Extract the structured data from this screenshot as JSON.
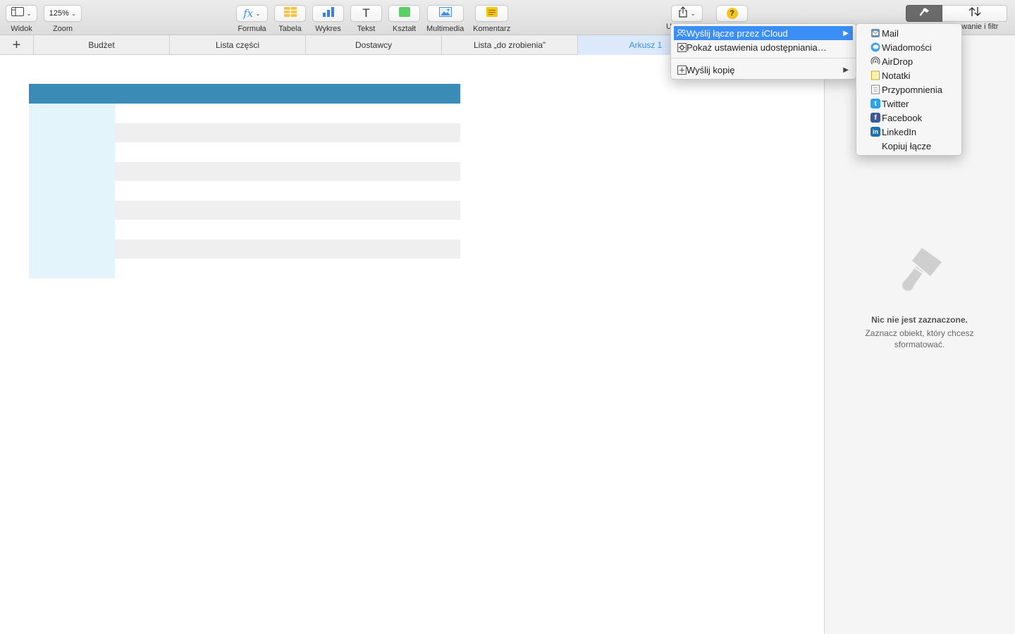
{
  "toolbar": {
    "view_label": "Widok",
    "zoom_value": "125%",
    "zoom_label": "Zoom",
    "formula_label": "Formuła",
    "table_label": "Tabela",
    "chart_label": "Wykres",
    "text_label": "Tekst",
    "text_icon_glyph": "T",
    "shape_label": "Kształt",
    "media_label": "Multimedia",
    "comment_label": "Komentarz",
    "share_label_clip": "U",
    "help_glyph": "?",
    "colors": {
      "table_icon": "#f5c242",
      "chart_icon": "#3d7fd9",
      "shape_icon": "#5dcf69",
      "comment_icon": "#f5c518",
      "formula_icon": "#3a8ef6"
    }
  },
  "tabs": {
    "add_glyph": "+",
    "items": [
      {
        "label": "Budżet"
      },
      {
        "label": "Lista części"
      },
      {
        "label": "Dostawcy"
      },
      {
        "label": "Lista „do zrobienia”"
      },
      {
        "label": "Arkusz 1",
        "active": true
      }
    ]
  },
  "table": {
    "header_color": "#3a8cb6",
    "side_color": "#e3f5fa",
    "stripe_color": "#efefef"
  },
  "sidebar": {
    "organize_label": "Sortowanie i filtr",
    "empty_title": "Nic nie jest zaznaczone.",
    "empty_subtitle": "Zaznacz obiekt, który chcesz sformatować."
  },
  "share_menu": {
    "items": [
      {
        "label": "Wyślij łącze przez iCloud",
        "highlighted": true,
        "has_submenu": true,
        "icon": "people-icon"
      },
      {
        "label": "Pokaż ustawienia udostępniania…",
        "icon": "gear-icon"
      },
      {
        "label": "Wyślij kopię",
        "has_submenu": true,
        "icon": "plus-box-icon"
      }
    ],
    "highlight_color": "#3a8ef6"
  },
  "submenu": {
    "items": [
      {
        "label": "Mail",
        "icon": "mail-icon"
      },
      {
        "label": "Wiadomości",
        "icon": "messages-icon"
      },
      {
        "label": "AirDrop",
        "icon": "airdrop-icon"
      },
      {
        "label": "Notatki",
        "icon": "notes-icon"
      },
      {
        "label": "Przypomnienia",
        "icon": "reminders-icon"
      },
      {
        "label": "Twitter",
        "icon": "twitter-icon"
      },
      {
        "label": "Facebook",
        "icon": "facebook-icon"
      },
      {
        "label": "LinkedIn",
        "icon": "linkedin-icon"
      },
      {
        "label": "Kopiuj łącze",
        "icon": ""
      }
    ]
  }
}
